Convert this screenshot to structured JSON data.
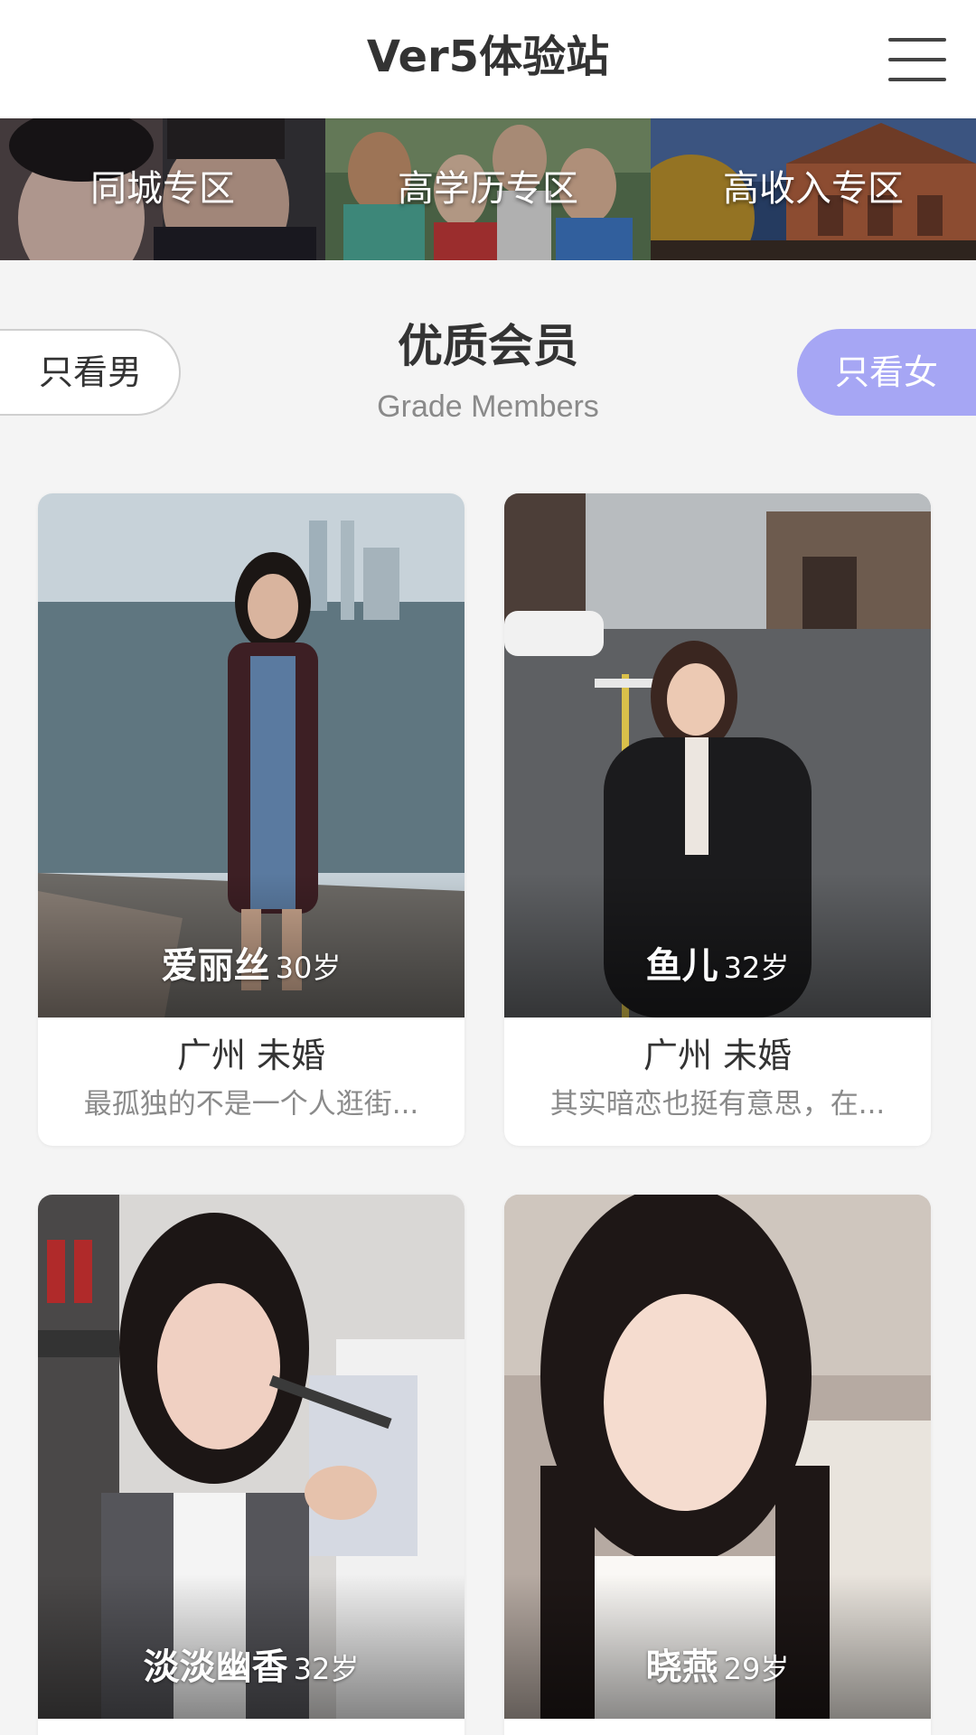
{
  "header": {
    "title": "Ver5体验站",
    "menu_icon": "hamburger-menu-icon"
  },
  "zones": [
    {
      "label": "同城专区"
    },
    {
      "label": "高学历专区"
    },
    {
      "label": "高收入专区"
    }
  ],
  "section": {
    "title": "优质会员",
    "subtitle": "Grade Members",
    "filter_male": "只看男",
    "filter_female": "只看女"
  },
  "colors": {
    "accent": "#a6a6f4",
    "background": "#f4f4f4",
    "card": "#ffffff",
    "muted_text": "#8a8a8a"
  },
  "members": [
    {
      "name": "爱丽丝",
      "age": "30岁",
      "location": "广州 未婚",
      "bio": "最孤独的不是一个人逛街..."
    },
    {
      "name": "鱼儿",
      "age": "32岁",
      "location": "广州 未婚",
      "bio": "其实暗恋也挺有意思，在..."
    },
    {
      "name": "淡淡幽香",
      "age": "32岁",
      "location": "",
      "bio": ""
    },
    {
      "name": "晓燕",
      "age": "29岁",
      "location": "",
      "bio": ""
    }
  ]
}
